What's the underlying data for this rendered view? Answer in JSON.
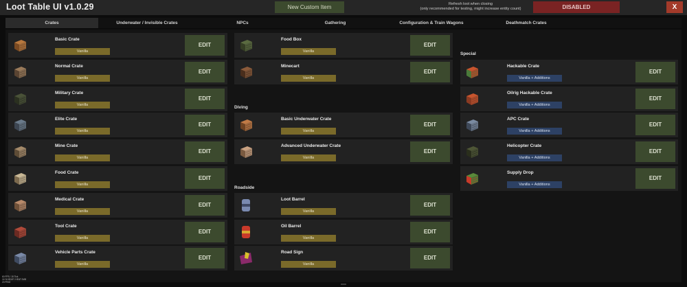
{
  "header": {
    "title": "Loot Table UI v1.0.29",
    "new_button": "New Custom Item",
    "refresh_text": "Refresh loot when closing\n(only recommended for testing, might increase entity count)",
    "refresh_state": "DISABLED",
    "close": "X"
  },
  "tabs": [
    {
      "label": "Crates",
      "active": true
    },
    {
      "label": "Underwater / Invisible Crates",
      "active": false
    },
    {
      "label": "NPCs",
      "active": false
    },
    {
      "label": "Gathering",
      "active": false
    },
    {
      "label": "Configuration & Train Wagons",
      "active": false
    },
    {
      "label": "Deathmatch Crates",
      "active": false
    }
  ],
  "edit_label": "EDIT",
  "colors": {
    "accent_green": "#3c4a2e",
    "vanilla_badge": "#7a6a2a",
    "additions_badge": "#2d4164",
    "disabled_red": "#7a2323",
    "close_red": "#a33a2a"
  },
  "columns": [
    {
      "items": [
        {
          "name": "Basic Crate",
          "badge": "Vanilla",
          "icon": "basic-crate-icon"
        },
        {
          "name": "Normal Crate",
          "badge": "Vanilla",
          "icon": "normal-crate-icon"
        },
        {
          "name": "Military Crate",
          "badge": "Vanilla",
          "icon": "military-crate-icon"
        },
        {
          "name": "Elite Crate",
          "badge": "Vanilla",
          "icon": "elite-crate-icon"
        },
        {
          "name": "Mine Crate",
          "badge": "Vanilla",
          "icon": "mine-crate-icon"
        },
        {
          "name": "Food Crate",
          "badge": "Vanilla",
          "icon": "food-crate-icon"
        },
        {
          "name": "Medical Crate",
          "badge": "Vanilla",
          "icon": "medical-crate-icon"
        },
        {
          "name": "Tool Crate",
          "badge": "Vanilla",
          "icon": "tool-crate-icon"
        },
        {
          "name": "Vehicle Parts Crate",
          "badge": "Vanilla",
          "icon": "vehicle-parts-crate-icon"
        }
      ]
    },
    {
      "items": [
        {
          "name": "Food Box",
          "badge": "Vanilla",
          "icon": "food-box-icon"
        },
        {
          "name": "Minecart",
          "badge": "Vanilla",
          "icon": "minecart-icon"
        }
      ],
      "sections": [
        {
          "title": "Diving",
          "items": [
            {
              "name": "Basic Underwater Crate",
              "badge": "Vanilla",
              "icon": "basic-underwater-crate-icon"
            },
            {
              "name": "Advanced Underwater Crate",
              "badge": "Vanilla",
              "icon": "advanced-underwater-crate-icon"
            }
          ]
        },
        {
          "title": "Roadside",
          "items": [
            {
              "name": "Loot Barrel",
              "badge": "Vanilla",
              "icon": "loot-barrel-icon"
            },
            {
              "name": "Oil Barrel",
              "badge": "Vanilla",
              "icon": "oil-barrel-icon"
            },
            {
              "name": "Road Sign",
              "badge": "Vanilla",
              "icon": "road-sign-icon"
            }
          ]
        }
      ]
    },
    {
      "sections": [
        {
          "title": "Special",
          "items": [
            {
              "name": "Hackable Crate",
              "badge": "Vanilla + Additions",
              "icon": "hackable-crate-icon"
            },
            {
              "name": "Oilrig Hackable Crate",
              "badge": "Vanilla + Additions",
              "icon": "oilrig-hackable-crate-icon"
            },
            {
              "name": "APC Crate",
              "badge": "Vanilla + Additions",
              "icon": "apc-crate-icon"
            },
            {
              "name": "Helicopter Crate",
              "badge": "Vanilla + Additions",
              "icon": "helicopter-crate-icon"
            },
            {
              "name": "Supply Drop",
              "badge": "Vanilla + Additions",
              "icon": "supply-drop-icon"
            }
          ]
        }
      ]
    }
  ],
  "footer_stats": [
    "60 FPS / 15 Tick",
    "16 % HEAP / HEAT 0MB",
    "20 PING"
  ]
}
